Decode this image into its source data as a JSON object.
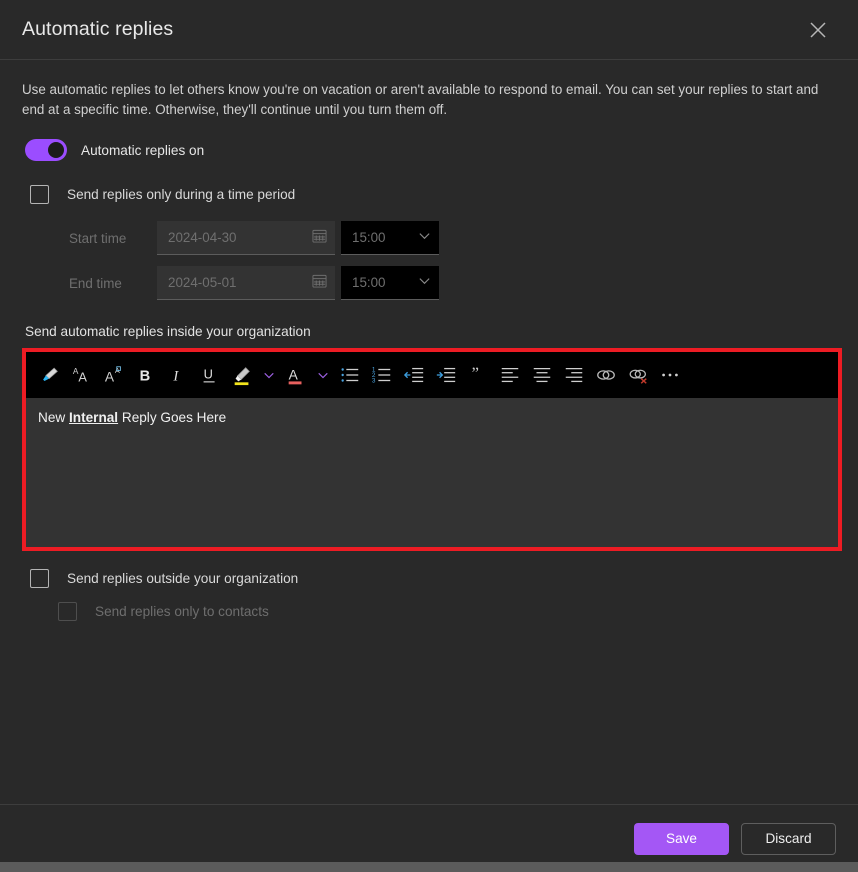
{
  "header": {
    "title": "Automatic replies",
    "close_icon": "close-icon"
  },
  "intro": "Use automatic replies to let others know you're on vacation or aren't available to respond to email. You can set your replies to start and end at a specific time. Otherwise, they'll continue until you turn them off.",
  "toggle": {
    "label": "Automatic replies on",
    "state": "on",
    "on_color": "#9b4dff"
  },
  "time_period": {
    "checkbox_label": "Send replies only during a time period",
    "checked": false,
    "start": {
      "label": "Start time",
      "date": "2024-04-30",
      "time": "15:00",
      "calendar_icon": "calendar-icon",
      "chevron_icon": "chevron-down-icon"
    },
    "end": {
      "label": "End time",
      "date": "2024-05-01",
      "time": "15:00",
      "calendar_icon": "calendar-icon",
      "chevron_icon": "chevron-down-icon"
    }
  },
  "internal": {
    "section_label": "Send automatic replies inside your organization",
    "highlight_color": "#ed1c24",
    "toolbar": [
      {
        "name": "format-painter-icon",
        "label": "Format painter"
      },
      {
        "name": "increase-font-size-icon",
        "label": "Increase font size"
      },
      {
        "name": "decrease-font-size-icon",
        "label": "Decrease font size"
      },
      {
        "name": "bold-icon",
        "label": "Bold"
      },
      {
        "name": "italic-icon",
        "label": "Italic"
      },
      {
        "name": "underline-icon",
        "label": "Underline"
      },
      {
        "name": "highlight-color-icon",
        "label": "Highlight"
      },
      {
        "name": "highlight-chevron-down-icon",
        "label": "Highlight options"
      },
      {
        "name": "font-color-icon",
        "label": "Font color"
      },
      {
        "name": "font-color-chevron-down-icon",
        "label": "Font color options"
      },
      {
        "name": "bulleted-list-icon",
        "label": "Bulleted list"
      },
      {
        "name": "numbered-list-icon",
        "label": "Numbered list"
      },
      {
        "name": "decrease-indent-icon",
        "label": "Decrease indent"
      },
      {
        "name": "increase-indent-icon",
        "label": "Increase indent"
      },
      {
        "name": "quote-icon",
        "label": "Quote"
      },
      {
        "name": "align-left-icon",
        "label": "Align left"
      },
      {
        "name": "align-center-icon",
        "label": "Align center"
      },
      {
        "name": "align-right-icon",
        "label": "Align right"
      },
      {
        "name": "insert-link-icon",
        "label": "Insert link"
      },
      {
        "name": "remove-link-icon",
        "label": "Remove link"
      },
      {
        "name": "more-options-icon",
        "label": "More options"
      }
    ],
    "message": {
      "before": "New ",
      "emphasis": "Internal",
      "after": " Reply Goes Here"
    }
  },
  "external": {
    "checkbox_label": "Send replies outside your organization",
    "checked": false,
    "contacts_checkbox_label": "Send replies only to contacts",
    "contacts_checked": false,
    "contacts_disabled": true
  },
  "footer": {
    "save_label": "Save",
    "discard_label": "Discard",
    "save_color": "#a457f5"
  }
}
